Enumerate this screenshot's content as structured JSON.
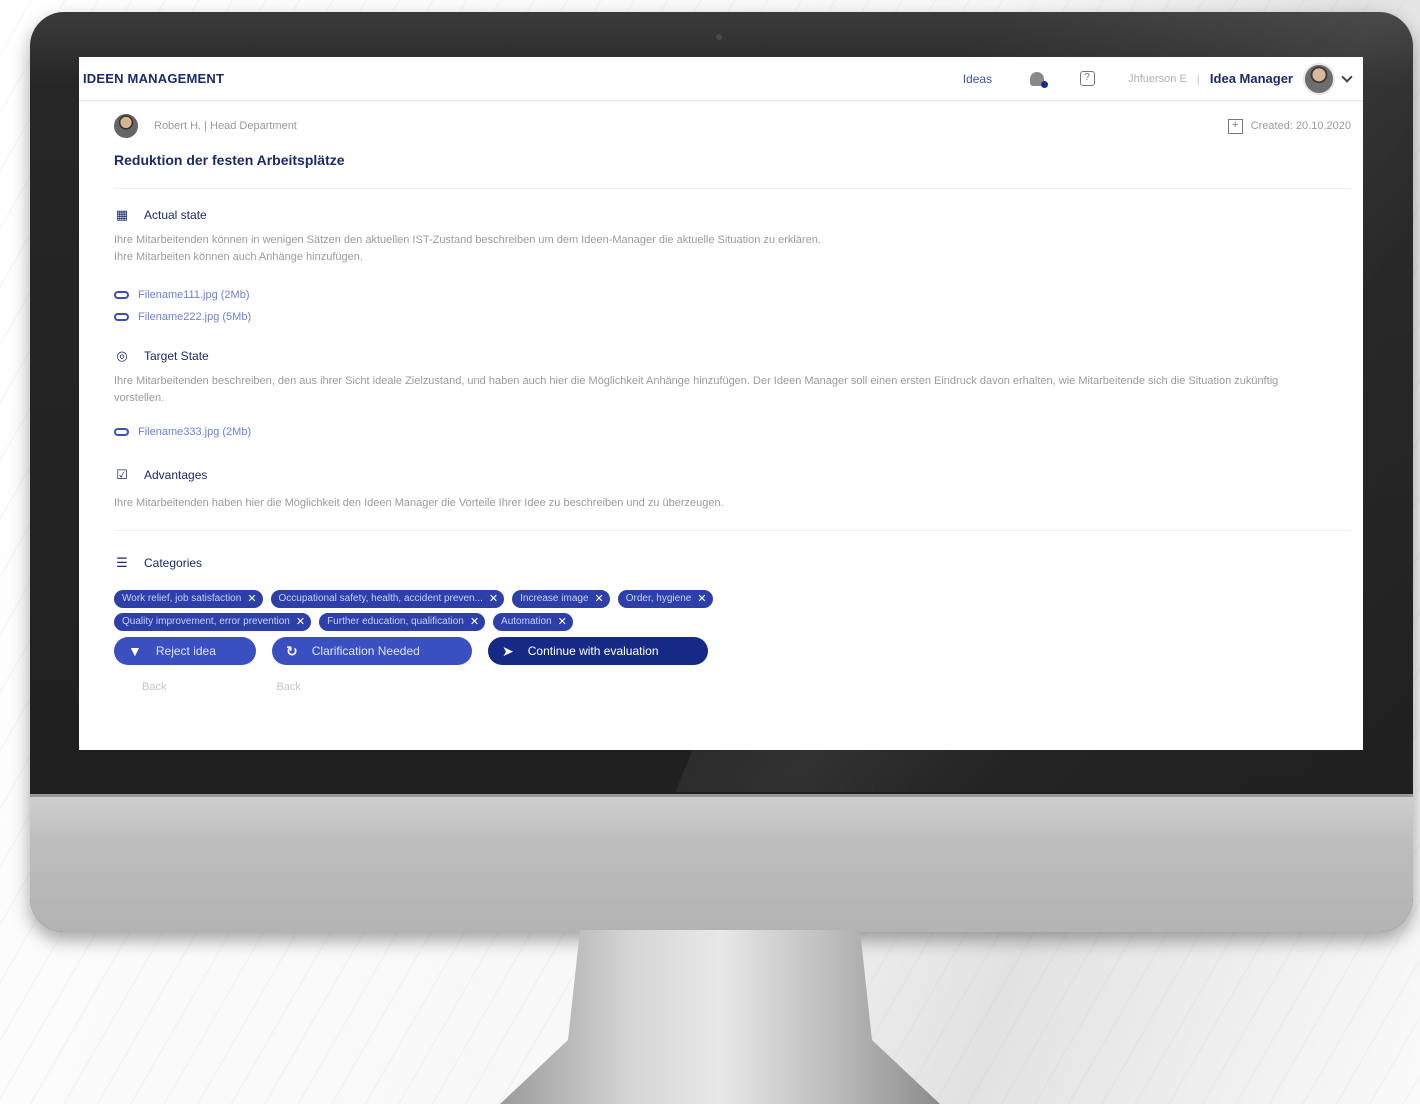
{
  "header": {
    "brand": "IDEEN MANAGEMENT",
    "nav_ideas": "Ideas",
    "user_name": "Jhfuerson E",
    "role": "Idea Manager"
  },
  "idea": {
    "author": "Robert H. | Head Department",
    "created": "Created: 20.10.2020",
    "title": "Reduktion der festen Arbeitsplätze"
  },
  "sections": {
    "actual": {
      "label": "Actual state",
      "line1": "Ihre Mitarbeitenden können in wenigen Sätzen den aktuellen IST-Zustand beschreiben um dem Ideen-Manager die aktuelle Situation zu erklären.",
      "line2": "Ihre Mitarbeiten können auch Anhänge hinzufügen.",
      "attachments": [
        "Filename111.jpg (2Mb)",
        "Filename222.jpg (5Mb)"
      ]
    },
    "target": {
      "label": "Target State",
      "text": "Ihre Mitarbeitenden beschreiben, den aus ihrer Sicht ideale Zielzustand, und haben auch hier die Möglichkeit Anhänge hinzufügen. Der Ideen Manager soll einen ersten Eindruck davon erhalten, wie Mitarbeitende sich die Situation zukünftig vorstellen.",
      "attachments": [
        "Filename333.jpg (2Mb)"
      ]
    },
    "advantages": {
      "label": "Advantages",
      "text": "Ihre Mitarbeitenden haben hier die Möglichkeit den Ideen Manager die Vorteile Ihrer Idee zu beschreiben und zu überzeugen."
    },
    "categories": {
      "label": "Categories",
      "row1": [
        "Work relief, job satisfaction",
        "Occupational safety, health, accident preven...",
        "Increase image",
        "Order, hygiene"
      ],
      "row2": [
        "Quality improvement, error prevention",
        "Further education, qualification",
        "Automation"
      ]
    }
  },
  "actions": {
    "reject": "Reject idea",
    "clarify": "Clarification Needed",
    "continue": "Continue with evaluation"
  },
  "footer": {
    "link1": "Back",
    "link2": "Back"
  },
  "colors": {
    "brand": "#1b2a6b",
    "chip": "#2d3fa8",
    "primary_button": "#142a85",
    "link": "#6a7fe0"
  }
}
